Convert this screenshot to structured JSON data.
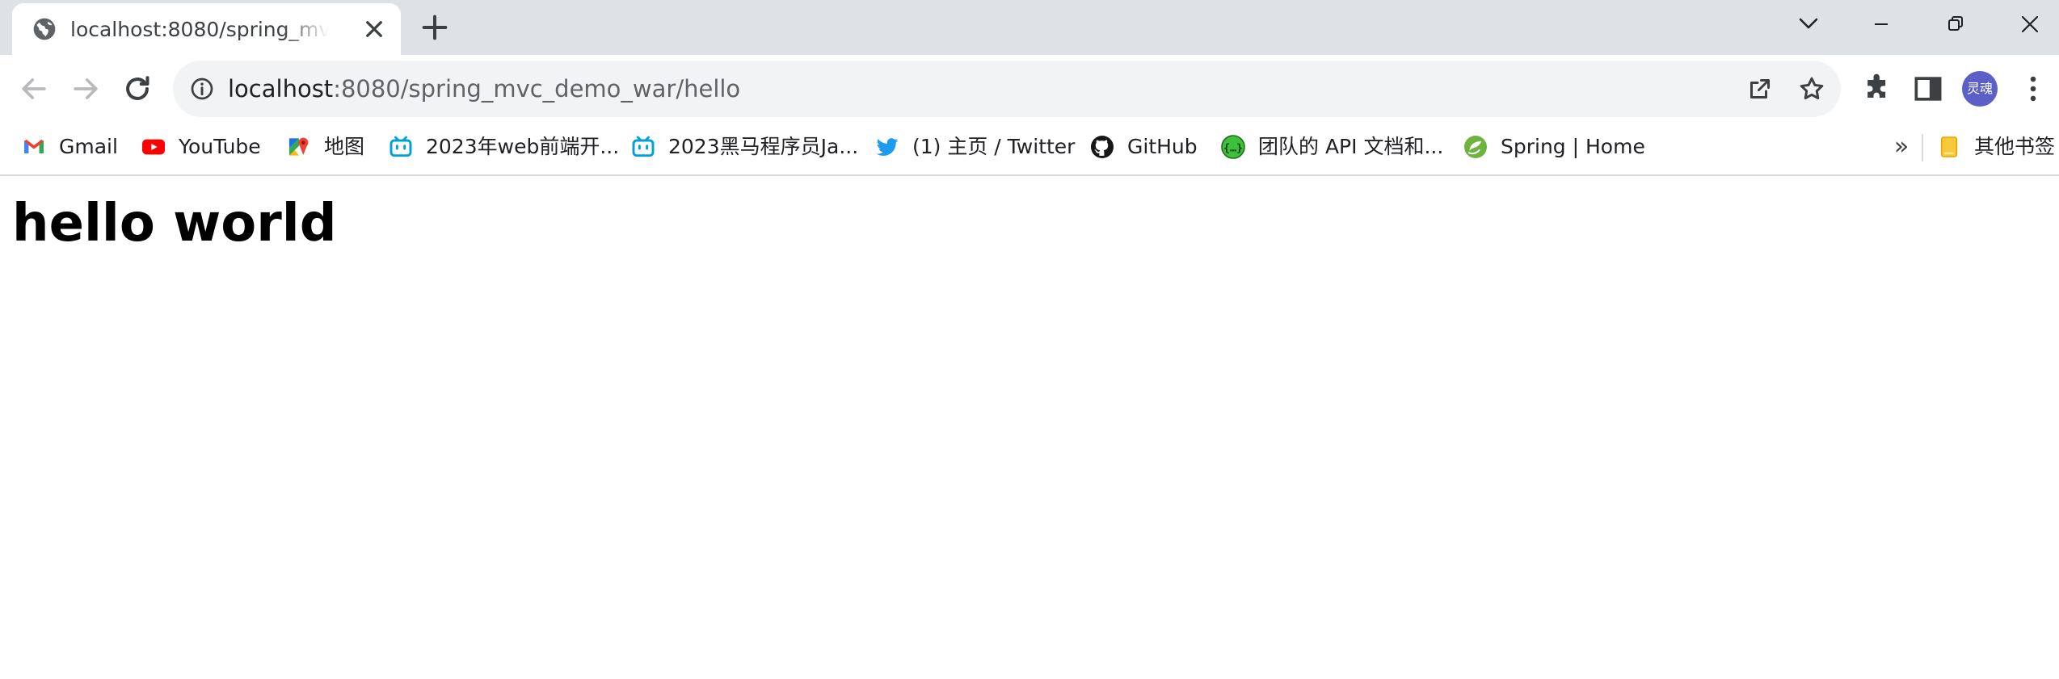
{
  "tab": {
    "title": "localhost:8080/spring_mvc_demo_war/hello",
    "favicon": "globe-icon",
    "close_icon": "close-icon"
  },
  "new_tab_icon": "plus-icon",
  "window_controls": [
    "chevron-down-icon",
    "minimize-icon",
    "restore-icon",
    "close-icon"
  ],
  "toolbar": {
    "back_icon": "arrow-left-icon",
    "forward_icon": "arrow-right-icon",
    "reload_icon": "reload-icon",
    "site_info_icon": "info-icon",
    "url_host": "localhost",
    "url_path": ":8080/spring_mvc_demo_war/hello",
    "share_icon": "share-icon",
    "bookmark_icon": "star-icon",
    "extensions_icon": "puzzle-icon",
    "side_panel_icon": "side-panel-icon",
    "profile_label": "灵魂",
    "menu_icon": "kebab-menu-icon"
  },
  "bookmarks": {
    "items": [
      {
        "label": "Gmail",
        "icon": "gmail-icon"
      },
      {
        "label": "YouTube",
        "icon": "youtube-icon"
      },
      {
        "label": "地图",
        "icon": "maps-icon"
      },
      {
        "label": "2023年web前端开...",
        "icon": "bilibili-icon"
      },
      {
        "label": "2023黑马程序员Ja...",
        "icon": "bilibili-icon"
      },
      {
        "label": "(1) 主页 / Twitter",
        "icon": "twitter-icon"
      },
      {
        "label": "GitHub",
        "icon": "github-icon"
      },
      {
        "label": "团队的 API 文档和...",
        "icon": "api-icon"
      },
      {
        "label": "Spring | Home",
        "icon": "spring-icon"
      }
    ],
    "more_label": "»",
    "other_bookmarks_label": "其他书签",
    "other_bookmarks_icon": "folder-icon"
  },
  "page": {
    "heading": "hello world"
  },
  "colors": {
    "tabstrip_bg": "#dee1e6",
    "omnibox_bg": "#f1f3f4",
    "avatar_bg": "#5b5fc7"
  }
}
